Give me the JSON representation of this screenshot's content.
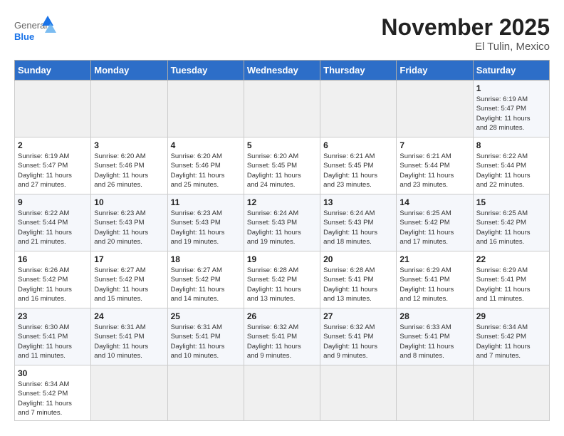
{
  "header": {
    "logo_general": "General",
    "logo_blue": "Blue",
    "month": "November 2025",
    "location": "El Tulin, Mexico"
  },
  "days_of_week": [
    "Sunday",
    "Monday",
    "Tuesday",
    "Wednesday",
    "Thursday",
    "Friday",
    "Saturday"
  ],
  "weeks": [
    [
      {
        "day": "",
        "info": ""
      },
      {
        "day": "",
        "info": ""
      },
      {
        "day": "",
        "info": ""
      },
      {
        "day": "",
        "info": ""
      },
      {
        "day": "",
        "info": ""
      },
      {
        "day": "",
        "info": ""
      },
      {
        "day": "1",
        "info": "Sunrise: 6:19 AM\nSunset: 5:47 PM\nDaylight: 11 hours\nand 28 minutes."
      }
    ],
    [
      {
        "day": "2",
        "info": "Sunrise: 6:19 AM\nSunset: 5:47 PM\nDaylight: 11 hours\nand 27 minutes."
      },
      {
        "day": "3",
        "info": "Sunrise: 6:20 AM\nSunset: 5:46 PM\nDaylight: 11 hours\nand 26 minutes."
      },
      {
        "day": "4",
        "info": "Sunrise: 6:20 AM\nSunset: 5:46 PM\nDaylight: 11 hours\nand 25 minutes."
      },
      {
        "day": "5",
        "info": "Sunrise: 6:20 AM\nSunset: 5:45 PM\nDaylight: 11 hours\nand 24 minutes."
      },
      {
        "day": "6",
        "info": "Sunrise: 6:21 AM\nSunset: 5:45 PM\nDaylight: 11 hours\nand 23 minutes."
      },
      {
        "day": "7",
        "info": "Sunrise: 6:21 AM\nSunset: 5:44 PM\nDaylight: 11 hours\nand 23 minutes."
      },
      {
        "day": "8",
        "info": "Sunrise: 6:22 AM\nSunset: 5:44 PM\nDaylight: 11 hours\nand 22 minutes."
      }
    ],
    [
      {
        "day": "9",
        "info": "Sunrise: 6:22 AM\nSunset: 5:44 PM\nDaylight: 11 hours\nand 21 minutes."
      },
      {
        "day": "10",
        "info": "Sunrise: 6:23 AM\nSunset: 5:43 PM\nDaylight: 11 hours\nand 20 minutes."
      },
      {
        "day": "11",
        "info": "Sunrise: 6:23 AM\nSunset: 5:43 PM\nDaylight: 11 hours\nand 19 minutes."
      },
      {
        "day": "12",
        "info": "Sunrise: 6:24 AM\nSunset: 5:43 PM\nDaylight: 11 hours\nand 19 minutes."
      },
      {
        "day": "13",
        "info": "Sunrise: 6:24 AM\nSunset: 5:43 PM\nDaylight: 11 hours\nand 18 minutes."
      },
      {
        "day": "14",
        "info": "Sunrise: 6:25 AM\nSunset: 5:42 PM\nDaylight: 11 hours\nand 17 minutes."
      },
      {
        "day": "15",
        "info": "Sunrise: 6:25 AM\nSunset: 5:42 PM\nDaylight: 11 hours\nand 16 minutes."
      }
    ],
    [
      {
        "day": "16",
        "info": "Sunrise: 6:26 AM\nSunset: 5:42 PM\nDaylight: 11 hours\nand 16 minutes."
      },
      {
        "day": "17",
        "info": "Sunrise: 6:27 AM\nSunset: 5:42 PM\nDaylight: 11 hours\nand 15 minutes."
      },
      {
        "day": "18",
        "info": "Sunrise: 6:27 AM\nSunset: 5:42 PM\nDaylight: 11 hours\nand 14 minutes."
      },
      {
        "day": "19",
        "info": "Sunrise: 6:28 AM\nSunset: 5:42 PM\nDaylight: 11 hours\nand 13 minutes."
      },
      {
        "day": "20",
        "info": "Sunrise: 6:28 AM\nSunset: 5:41 PM\nDaylight: 11 hours\nand 13 minutes."
      },
      {
        "day": "21",
        "info": "Sunrise: 6:29 AM\nSunset: 5:41 PM\nDaylight: 11 hours\nand 12 minutes."
      },
      {
        "day": "22",
        "info": "Sunrise: 6:29 AM\nSunset: 5:41 PM\nDaylight: 11 hours\nand 11 minutes."
      }
    ],
    [
      {
        "day": "23",
        "info": "Sunrise: 6:30 AM\nSunset: 5:41 PM\nDaylight: 11 hours\nand 11 minutes."
      },
      {
        "day": "24",
        "info": "Sunrise: 6:31 AM\nSunset: 5:41 PM\nDaylight: 11 hours\nand 10 minutes."
      },
      {
        "day": "25",
        "info": "Sunrise: 6:31 AM\nSunset: 5:41 PM\nDaylight: 11 hours\nand 10 minutes."
      },
      {
        "day": "26",
        "info": "Sunrise: 6:32 AM\nSunset: 5:41 PM\nDaylight: 11 hours\nand 9 minutes."
      },
      {
        "day": "27",
        "info": "Sunrise: 6:32 AM\nSunset: 5:41 PM\nDaylight: 11 hours\nand 9 minutes."
      },
      {
        "day": "28",
        "info": "Sunrise: 6:33 AM\nSunset: 5:41 PM\nDaylight: 11 hours\nand 8 minutes."
      },
      {
        "day": "29",
        "info": "Sunrise: 6:34 AM\nSunset: 5:42 PM\nDaylight: 11 hours\nand 7 minutes."
      }
    ],
    [
      {
        "day": "30",
        "info": "Sunrise: 6:34 AM\nSunset: 5:42 PM\nDaylight: 11 hours\nand 7 minutes."
      },
      {
        "day": "",
        "info": ""
      },
      {
        "day": "",
        "info": ""
      },
      {
        "day": "",
        "info": ""
      },
      {
        "day": "",
        "info": ""
      },
      {
        "day": "",
        "info": ""
      },
      {
        "day": "",
        "info": ""
      }
    ]
  ]
}
